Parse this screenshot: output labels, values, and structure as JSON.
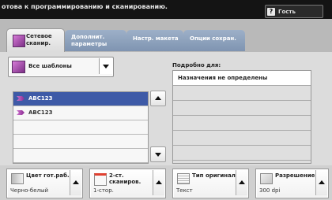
{
  "header": {
    "status_text": "отова к программированию и сканированию.",
    "guest_label": "Гость",
    "guest_icon": "question-icon"
  },
  "tabs": [
    {
      "label": "Сетевое сканир.",
      "active": true
    },
    {
      "label": "Дополнит. параметры",
      "active": false
    },
    {
      "label": "Настр. макета",
      "active": false
    },
    {
      "label": "Опции сохран.",
      "active": false
    }
  ],
  "template_selector": {
    "label": "Все шаблоны",
    "icon": "scan-template-icon"
  },
  "template_list": {
    "items": [
      {
        "label": "ABC123",
        "selected": true
      },
      {
        "label": "ABC123",
        "selected": false
      },
      {
        "label": "",
        "selected": false
      },
      {
        "label": "",
        "selected": false
      },
      {
        "label": "",
        "selected": false
      }
    ]
  },
  "details": {
    "title": "Подробно для:",
    "rows": [
      "Назначения не определены",
      "",
      "",
      "",
      "",
      ""
    ]
  },
  "bottom_controls": [
    {
      "title": "Цвет гот.раб.",
      "value": "Черно-белый",
      "icon": "color-mode-icon"
    },
    {
      "title": "2-ст. сканиров.",
      "value": "1-стор.",
      "icon": "sided-scan-icon"
    },
    {
      "title": "Тип оригинала",
      "value": "Текст",
      "icon": "original-type-icon"
    },
    {
      "title": "Разрешение",
      "value": "300 dpi",
      "icon": "resolution-icon"
    }
  ]
}
